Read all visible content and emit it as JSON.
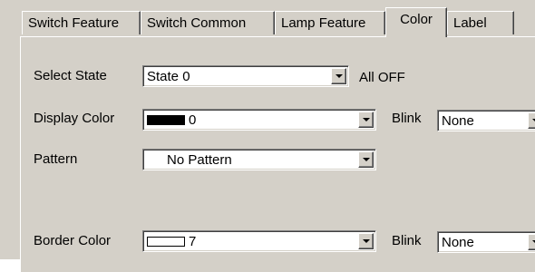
{
  "tabs": [
    {
      "label": "Switch Feature"
    },
    {
      "label": "Switch Common"
    },
    {
      "label": "Lamp Feature"
    },
    {
      "label": "Color"
    },
    {
      "label": "Label"
    }
  ],
  "active_tab": "Color",
  "select_state": {
    "label": "Select State",
    "value": "State 0",
    "note": "All OFF"
  },
  "display_color": {
    "label": "Display Color",
    "value": "0",
    "swatch_color": "#000000",
    "blink_label": "Blink",
    "blink_value": "None"
  },
  "pattern": {
    "label": "Pattern",
    "value": "No Pattern"
  },
  "border_color": {
    "label": "Border Color",
    "value": "7",
    "swatch_color": "#ffffff",
    "blink_label": "Blink",
    "blink_value": "None"
  },
  "icons": {
    "dropdown": "chevron-down-icon"
  }
}
